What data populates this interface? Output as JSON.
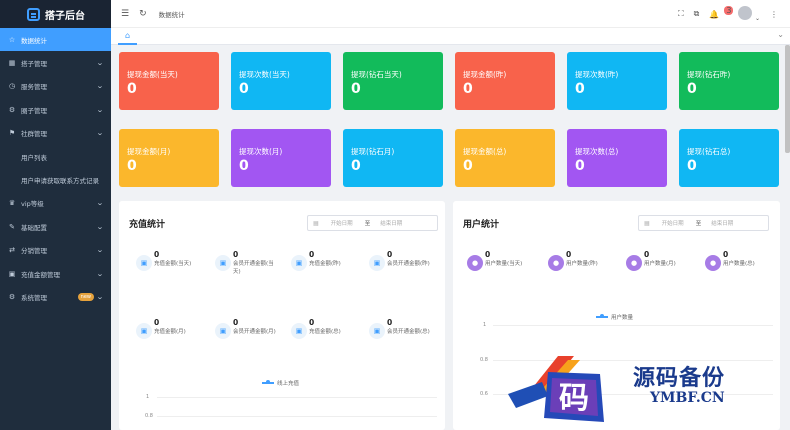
{
  "brand": {
    "name": "搭子后台"
  },
  "sidebar": {
    "items": [
      {
        "label": "数据统计",
        "icon": "star-icon",
        "active": true,
        "arrow": false
      },
      {
        "label": "搭子管理",
        "icon": "grid-icon",
        "arrow": true
      },
      {
        "label": "服务管理",
        "icon": "clock-icon",
        "arrow": true
      },
      {
        "label": "圈子管理",
        "icon": "gear-icon",
        "arrow": true
      },
      {
        "label": "社群管理",
        "icon": "flag-icon",
        "arrow": true
      },
      {
        "label": "用户列表",
        "icon": "",
        "arrow": false
      },
      {
        "label": "用户申请获取联系方式记录",
        "icon": "",
        "arrow": false
      },
      {
        "label": "vip等级",
        "icon": "vip-icon",
        "arrow": true
      },
      {
        "label": "基础配置",
        "icon": "wrench-icon",
        "arrow": true
      },
      {
        "label": "分销管理",
        "icon": "share-icon",
        "arrow": true
      },
      {
        "label": "充值金额管理",
        "icon": "wallet-icon",
        "arrow": true
      },
      {
        "label": "系统管理",
        "icon": "settings-icon",
        "arrow": true,
        "badge": "new"
      }
    ]
  },
  "header": {
    "breadcrumb": "数据统计"
  },
  "notifications": {
    "count": "3"
  },
  "cards": [
    {
      "label": "提现金额(当天)",
      "value": "0",
      "color": "#f8624b"
    },
    {
      "label": "提现次数(当天)",
      "value": "0",
      "color": "#10b7f3"
    },
    {
      "label": "提现(钻石当天)",
      "value": "0",
      "color": "#12bb5b"
    },
    {
      "label": "提现金额(昨)",
      "value": "0",
      "color": "#f8624b"
    },
    {
      "label": "提现次数(昨)",
      "value": "0",
      "color": "#10b7f3"
    },
    {
      "label": "提现(钻石昨)",
      "value": "0",
      "color": "#12bb5b"
    },
    {
      "label": "提现金额(月)",
      "value": "0",
      "color": "#fbb72c"
    },
    {
      "label": "提现次数(月)",
      "value": "0",
      "color": "#a256f2"
    },
    {
      "label": "提现(钻石月)",
      "value": "0",
      "color": "#10b7f3"
    },
    {
      "label": "提现金额(总)",
      "value": "0",
      "color": "#fbb72c"
    },
    {
      "label": "提现次数(总)",
      "value": "0",
      "color": "#a256f2"
    },
    {
      "label": "提现(钻石总)",
      "value": "0",
      "color": "#10b7f3"
    }
  ],
  "recharge": {
    "title": "充值统计",
    "date_from": "开始日期",
    "date_sep": "至",
    "date_to": "结束日期",
    "stats": [
      {
        "value": "0",
        "label": "充值金额(当天)"
      },
      {
        "value": "0",
        "label": "会员开通金额(当天)"
      },
      {
        "value": "0",
        "label": "充值金额(昨)"
      },
      {
        "value": "0",
        "label": "会员开通金额(昨)"
      },
      {
        "value": "0",
        "label": "充值金额(月)"
      },
      {
        "value": "0",
        "label": "会员开通金额(月)"
      },
      {
        "value": "0",
        "label": "充值金额(总)"
      },
      {
        "value": "0",
        "label": "会员开通金额(总)"
      }
    ],
    "legend": "线上充值",
    "y_ticks": [
      "1",
      "0.8"
    ]
  },
  "users": {
    "title": "用户统计",
    "date_from": "开始日期",
    "date_sep": "至",
    "date_to": "结束日期",
    "stats": [
      {
        "value": "0",
        "label": "用户数量(当天)"
      },
      {
        "value": "0",
        "label": "用户数量(昨)"
      },
      {
        "value": "0",
        "label": "用户数量(月)"
      },
      {
        "value": "0",
        "label": "用户数量(总)"
      }
    ],
    "legend": "用户数量",
    "y_ticks": [
      "1",
      "0.8",
      "0.6"
    ]
  },
  "chart_data": [
    {
      "type": "line",
      "series": [
        {
          "name": "线上充值",
          "values": []
        }
      ],
      "y_ticks": [
        1,
        0.8
      ]
    },
    {
      "type": "line",
      "series": [
        {
          "name": "用户数量",
          "values": []
        }
      ],
      "y_ticks": [
        1,
        0.8,
        0.6
      ]
    }
  ],
  "watermark": {
    "cn": "源码备份",
    "en": "YMBF.CN",
    "mark": "码"
  }
}
